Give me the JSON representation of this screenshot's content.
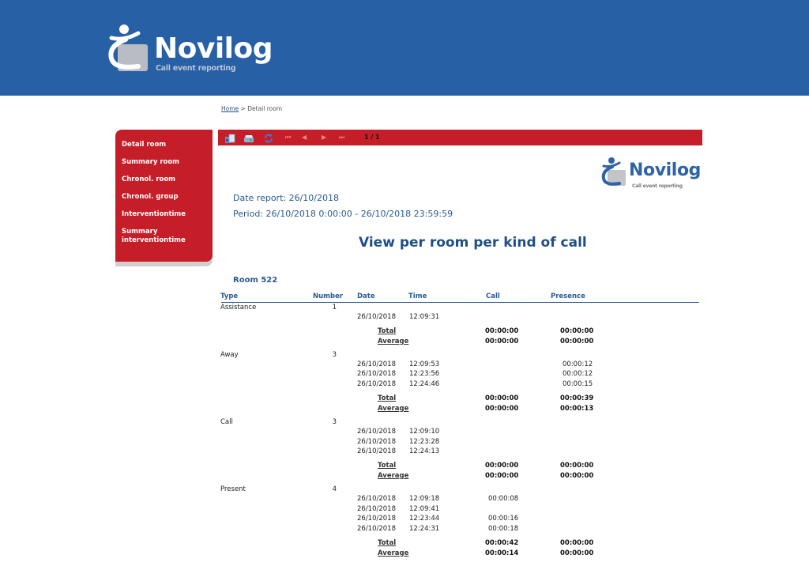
{
  "header": {
    "logo_word": "Novilog",
    "logo_tagline": "Call event reporting",
    "brand_color": "#2860a6",
    "accent_color": "#c61e28"
  },
  "breadcrumb": {
    "home": "Home",
    "separator": ">",
    "current": "Detail room"
  },
  "sidebar": {
    "items": [
      {
        "label": "Detail room"
      },
      {
        "label": "Summary room"
      },
      {
        "label": "Chronol. room"
      },
      {
        "label": "Chronol. group"
      },
      {
        "label": "Interventiontime"
      },
      {
        "label": "Summary interventiontime"
      }
    ]
  },
  "toolbar": {
    "icons": [
      "export-icon",
      "print-icon",
      "refresh-icon"
    ],
    "nav": {
      "first": "⏮",
      "prev": "◀",
      "next": "▶",
      "last": "⏭"
    },
    "page": "1 / 1"
  },
  "report": {
    "logo_word": "Novilog",
    "logo_tagline": "Call event reporting",
    "date_report": "Date report: 26/10/2018",
    "period": "Period: 26/10/2018 0:00:00 - 26/10/2018 23:59:59",
    "title": "View per room per kind of call",
    "room": "Room 522",
    "columns": [
      "Type",
      "Number",
      "Date",
      "Time",
      "Call",
      "Presence"
    ],
    "total_label": "Total",
    "average_label": "Average",
    "groups": [
      {
        "type": "Assistance",
        "number": "1",
        "rows": [
          {
            "date": "26/10/2018",
            "time": "12:09:31",
            "call": "",
            "presence": ""
          }
        ],
        "total": {
          "call": "00:00:00",
          "presence": "00:00:00"
        },
        "average": {
          "call": "00:00:00",
          "presence": "00:00:00"
        }
      },
      {
        "type": "Away",
        "number": "3",
        "rows": [
          {
            "date": "26/10/2018",
            "time": "12:09:53",
            "call": "",
            "presence": "00:00:12"
          },
          {
            "date": "26/10/2018",
            "time": "12:23:56",
            "call": "",
            "presence": "00:00:12"
          },
          {
            "date": "26/10/2018",
            "time": "12:24:46",
            "call": "",
            "presence": "00:00:15"
          }
        ],
        "total": {
          "call": "00:00:00",
          "presence": "00:00:39"
        },
        "average": {
          "call": "00:00:00",
          "presence": "00:00:13"
        }
      },
      {
        "type": "Call",
        "number": "3",
        "rows": [
          {
            "date": "26/10/2018",
            "time": "12:09:10",
            "call": "",
            "presence": ""
          },
          {
            "date": "26/10/2018",
            "time": "12:23:28",
            "call": "",
            "presence": ""
          },
          {
            "date": "26/10/2018",
            "time": "12:24:13",
            "call": "",
            "presence": ""
          }
        ],
        "total": {
          "call": "00:00:00",
          "presence": "00:00:00"
        },
        "average": {
          "call": "00:00:00",
          "presence": "00:00:00"
        }
      },
      {
        "type": "Present",
        "number": "4",
        "rows": [
          {
            "date": "26/10/2018",
            "time": "12:09:18",
            "call": "00:00:08",
            "presence": ""
          },
          {
            "date": "26/10/2018",
            "time": "12:09:41",
            "call": "",
            "presence": ""
          },
          {
            "date": "26/10/2018",
            "time": "12:23:44",
            "call": "00:00:16",
            "presence": ""
          },
          {
            "date": "26/10/2018",
            "time": "12:24:31",
            "call": "00:00:18",
            "presence": ""
          }
        ],
        "total": {
          "call": "00:00:42",
          "presence": "00:00:00"
        },
        "average": {
          "call": "00:00:14",
          "presence": "00:00:00"
        }
      }
    ]
  }
}
